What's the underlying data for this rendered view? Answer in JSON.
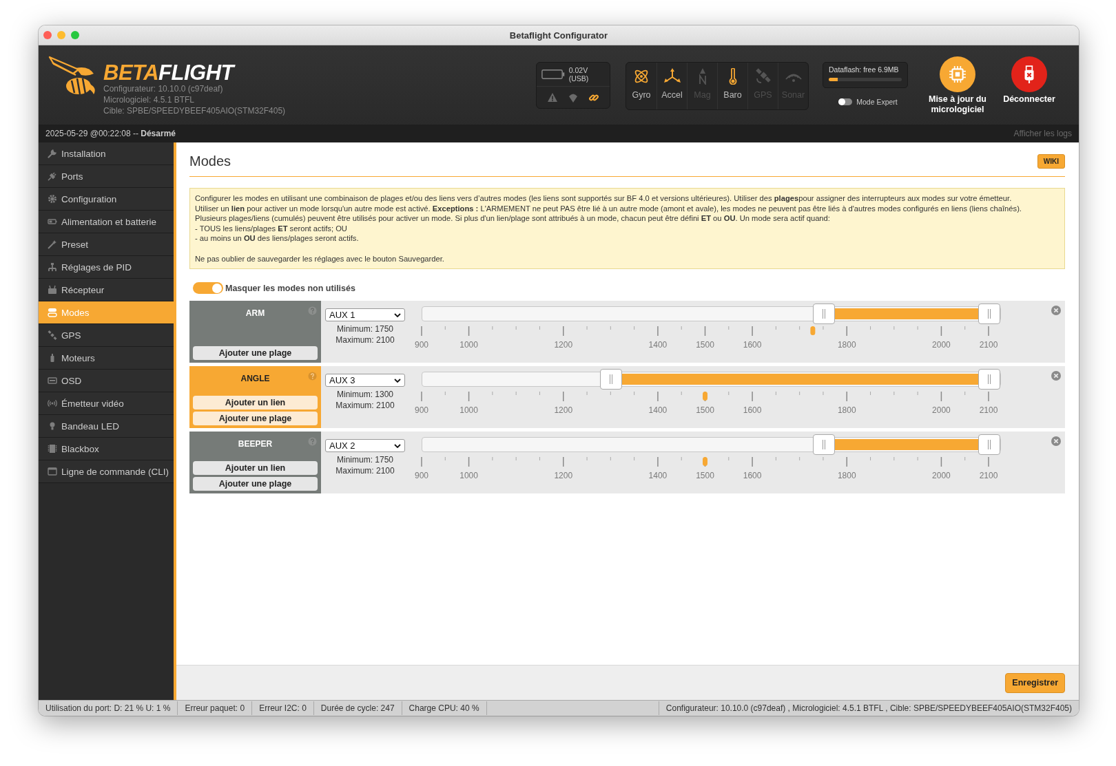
{
  "window": {
    "title": "Betaflight Configurator"
  },
  "header": {
    "logo": {
      "accent": "BETA",
      "rest": "FLIGHT"
    },
    "info": [
      "Configurateur: 10.10.0 (c97deaf)",
      "Micrologiciel: 4.5.1 BTFL",
      "Cible: SPBE/SPEEDYBEEF405AIO(STM32F405)"
    ],
    "battery": {
      "reading": "0.02V (USB)"
    },
    "status_icons": [
      {
        "on": false
      },
      {
        "on": false
      },
      {
        "on": true
      }
    ],
    "sensors": [
      {
        "label": "Gyro",
        "on": true
      },
      {
        "label": "Accel",
        "on": true
      },
      {
        "label": "Mag",
        "on": false
      },
      {
        "label": "Baro",
        "on": true
      },
      {
        "label": "GPS",
        "on": false
      },
      {
        "label": "Sonar",
        "on": false
      }
    ],
    "dataflash": {
      "label": "Dataflash: free 6.9MB",
      "level": 0.12
    },
    "expert_mode": {
      "label": "Mode Expert",
      "on": false
    },
    "update_button": "Mise à jour du micrologiciel",
    "disconnect_button": "Déconnecter"
  },
  "status_strip": {
    "datetime": "2025-05-29 @00:22:08 -- **Désarmé**",
    "logs_link": "Afficher les logs"
  },
  "sidebar": {
    "items": [
      {
        "label": "Installation",
        "selected": false
      },
      {
        "label": "Ports",
        "selected": false
      },
      {
        "label": "Configuration",
        "selected": false
      },
      {
        "label": "Alimentation et batterie",
        "selected": false
      },
      {
        "label": "Preset",
        "selected": false
      },
      {
        "label": "Réglages de PID",
        "selected": false
      },
      {
        "label": "Récepteur",
        "selected": false
      },
      {
        "label": "Modes",
        "selected": true
      },
      {
        "label": "GPS",
        "selected": false
      },
      {
        "label": "Moteurs",
        "selected": false
      },
      {
        "label": "OSD",
        "selected": false
      },
      {
        "label": "Émetteur vidéo",
        "selected": false
      },
      {
        "label": "Bandeau LED",
        "selected": false
      },
      {
        "label": "Blackbox",
        "selected": false
      },
      {
        "label": "Ligne de commande (CLI)",
        "selected": false
      }
    ]
  },
  "page": {
    "title": "Modes",
    "wiki_button": "WIKI",
    "notice": {
      "lines": [
        "Configurer les modes en utilisant une combinaison de plages et/ou des liens vers d’autres modes (les liens sont supportés sur BF 4.0 et versions ultérieures). Utiliser des **plages**pour assigner des interrupteurs aux modes sur votre émetteur.",
        "Utiliser un **lien** pour activer un mode lorsqu'un autre mode est activé. **Exceptions :** L'ARMEMENT ne peut PAS être lié à un autre mode (amont et avale), les modes ne peuvent pas être liés à d'autres modes configurés en liens (liens chaînés).",
        "Plusieurs plages/liens (cumulés) peuvent être utilisés pour activer un mode. Si plus d'un lien/plage sont attribués à un mode, chacun peut être défini **ET** ou **OU**. Un mode sera actif quand:",
        "- TOUS les liens/plages **ET** seront actifs; OU",
        "- au moins un **OU** des liens/plages seront actifs."
      ],
      "reminder": "Ne pas oublier de sauvegarder les réglages avec le bouton Sauvegarder."
    },
    "hide_unused": {
      "label": "Masquer les modes non utilisés",
      "on": true
    }
  },
  "modes": [
    {
      "name": "ARM",
      "active": false,
      "channel": "AUX 1",
      "minimum": "Minimum: 1750",
      "maximum": "Maximum: 2100",
      "handles": [
        {
          "level": 0.708
        },
        {
          "level": 1
        }
      ],
      "marker": {
        "level": 0.69
      },
      "scale": [
        "900",
        "1000",
        "1200",
        "1400",
        "1500",
        "1600",
        "1800",
        "2000",
        "2100"
      ],
      "buttons": [
        "Ajouter une plage"
      ]
    },
    {
      "name": "ANGLE",
      "active": true,
      "channel": "AUX 3",
      "minimum": "Minimum: 1300",
      "maximum": "Maximum: 2100",
      "handles": [
        {
          "level": 0.333
        },
        {
          "level": 1
        }
      ],
      "marker": {
        "level": 0.5
      },
      "scale": [
        "900",
        "1000",
        "1200",
        "1400",
        "1500",
        "1600",
        "1800",
        "2000",
        "2100"
      ],
      "buttons": [
        "Ajouter un lien",
        "Ajouter une plage"
      ]
    },
    {
      "name": "BEEPER",
      "active": false,
      "channel": "AUX 2",
      "minimum": "Minimum: 1750",
      "maximum": "Maximum: 2100",
      "handles": [
        {
          "level": 0.708
        },
        {
          "level": 1
        }
      ],
      "marker": {
        "level": 0.5
      },
      "scale": [
        "900",
        "1000",
        "1200",
        "1400",
        "1500",
        "1600",
        "1800",
        "2000",
        "2100"
      ],
      "buttons": [
        "Ajouter un lien",
        "Ajouter une plage"
      ]
    }
  ],
  "save_button": "Enregistrer",
  "status_bar": {
    "items": [
      "Utilisation du port: D: 21 % U: 1 %",
      "Erreur paquet: 0",
      "Erreur I2C: 0",
      "Durée de cycle: 247",
      "Charge CPU: 40 %"
    ],
    "version": "Configurateur: 10.10.0 (c97deaf) , Micrologiciel: 4.5.1 BTFL , Cible: SPBE/SPEEDYBEEF405AIO(STM32F405)"
  }
}
